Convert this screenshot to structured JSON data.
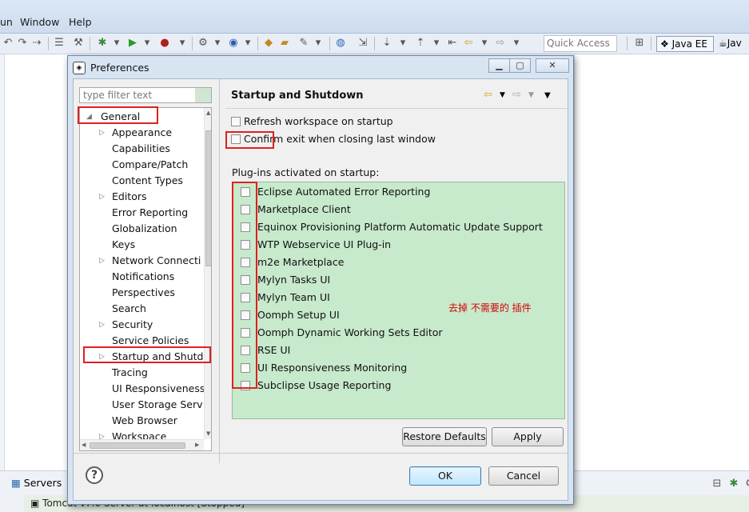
{
  "menubar": {
    "items": [
      "un",
      "Window",
      "Help"
    ]
  },
  "toolbar": {
    "quick_access_placeholder": "Quick Access"
  },
  "perspectives": {
    "java_ee": "Java EE",
    "java": "Jav"
  },
  "bottom_panel": {
    "tab_label": "Servers",
    "row_text": "Tomcat v7.0 Server at localhost  [Stopped]"
  },
  "dialog": {
    "title": "Preferences",
    "filter_placeholder": "type filter text",
    "tree": {
      "root": "General",
      "items": [
        {
          "label": "Appearance",
          "expandable": true
        },
        {
          "label": "Capabilities",
          "expandable": false
        },
        {
          "label": "Compare/Patch",
          "expandable": false
        },
        {
          "label": "Content Types",
          "expandable": false
        },
        {
          "label": "Editors",
          "expandable": true
        },
        {
          "label": "Error Reporting",
          "expandable": false
        },
        {
          "label": "Globalization",
          "expandable": false
        },
        {
          "label": "Keys",
          "expandable": false
        },
        {
          "label": "Network Connecti",
          "expandable": true
        },
        {
          "label": "Notifications",
          "expandable": false
        },
        {
          "label": "Perspectives",
          "expandable": false
        },
        {
          "label": "Search",
          "expandable": false
        },
        {
          "label": "Security",
          "expandable": true
        },
        {
          "label": "Service Policies",
          "expandable": false
        },
        {
          "label": "Startup and Shutd",
          "expandable": true
        },
        {
          "label": "Tracing",
          "expandable": false
        },
        {
          "label": "UI Responsiveness",
          "expandable": false
        },
        {
          "label": "User Storage Serv",
          "expandable": false
        },
        {
          "label": "Web Browser",
          "expandable": false
        },
        {
          "label": "Workspace",
          "expandable": true
        }
      ]
    },
    "page": {
      "title": "Startup and Shutdown",
      "options": [
        {
          "label": "Refresh workspace on startup",
          "checked": false
        },
        {
          "label": "Confirm exit when closing last window",
          "checked": false
        }
      ],
      "plugins_label": "Plug-ins activated on startup:",
      "plugins": [
        {
          "label": "Eclipse Automated Error Reporting",
          "checked": false
        },
        {
          "label": "Marketplace Client",
          "checked": false
        },
        {
          "label": "Equinox Provisioning Platform Automatic Update Support",
          "checked": false
        },
        {
          "label": "WTP Webservice UI Plug-in",
          "checked": false
        },
        {
          "label": "m2e Marketplace",
          "checked": false
        },
        {
          "label": "Mylyn Tasks UI",
          "checked": false
        },
        {
          "label": "Mylyn Team UI",
          "checked": false
        },
        {
          "label": "Oomph Setup UI",
          "checked": false
        },
        {
          "label": "Oomph Dynamic Working Sets Editor",
          "checked": false
        },
        {
          "label": "RSE UI",
          "checked": false
        },
        {
          "label": "UI Responsiveness Monitoring",
          "checked": false
        },
        {
          "label": "Subclipse Usage Reporting",
          "checked": false
        }
      ],
      "annotation": "去掉 不需要的 插件",
      "restore_defaults_label": "Restore Defaults",
      "apply_label": "Apply"
    },
    "ok_label": "OK",
    "cancel_label": "Cancel"
  },
  "colors": {
    "plugins_bg": "#c7e9cc",
    "annotation_red": "#e02020",
    "dialog_frame": "#d7e4f2"
  }
}
